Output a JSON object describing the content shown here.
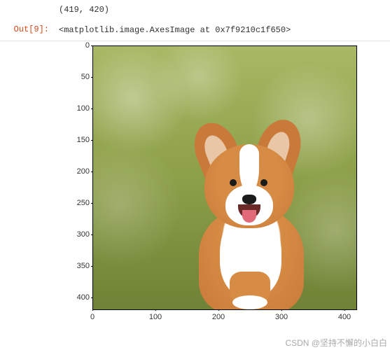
{
  "cells": {
    "out9": {
      "prompt": "Out[9]:",
      "stdout": "(419, 420)",
      "repr": "<matplotlib.image.AxesImage at 0x7f9210c1f650>"
    }
  },
  "chart_data": {
    "type": "image",
    "title": "",
    "xlabel": "",
    "ylabel": "",
    "xlim": [
      0,
      420
    ],
    "ylim": [
      420,
      0
    ],
    "xticks": [
      0,
      100,
      200,
      300,
      400
    ],
    "yticks": [
      0,
      50,
      100,
      150,
      200,
      250,
      300,
      350,
      400
    ],
    "image_shape": [
      419,
      420
    ],
    "content_description": "corgi dog on blurred green bokeh background"
  },
  "watermark": "CSDN @坚持不懈的小白白"
}
